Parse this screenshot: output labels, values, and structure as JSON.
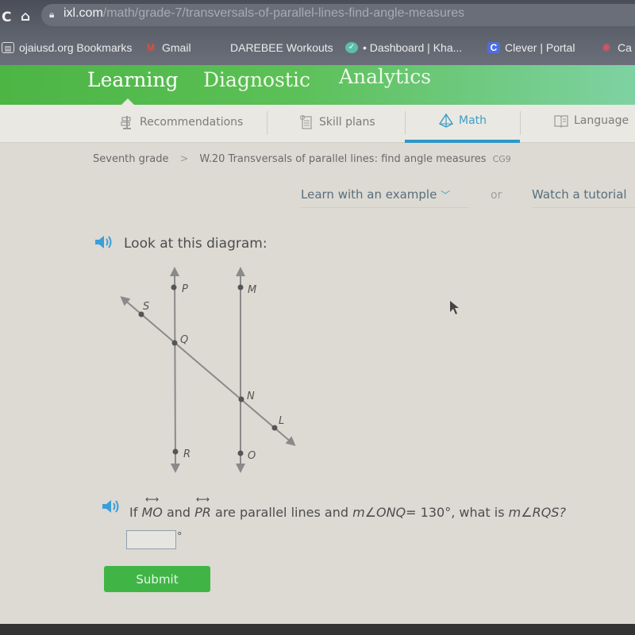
{
  "browser": {
    "reload_icon": "reload-icon",
    "home_icon": "home-icon",
    "lock_icon": "lock-icon",
    "url_host": "ixl.com",
    "url_path": "/math/grade-7/transversals-of-parallel-lines-find-angle-measures",
    "bookmarks": [
      {
        "label": "ojaiusd.org Bookmarks",
        "icon": "folder-icon"
      },
      {
        "label": "Gmail",
        "icon": "gmail-icon"
      },
      {
        "label": "DAREBEE Workouts",
        "icon": ""
      },
      {
        "label": "• Dashboard | Kha...",
        "icon": "khan-academy-icon"
      },
      {
        "label": "Clever | Portal",
        "icon": "clever-icon"
      },
      {
        "label": "Ca",
        "icon": "canvas-icon"
      }
    ]
  },
  "top_nav": {
    "items": [
      "Learning",
      "Diagnostic",
      "Analytics"
    ],
    "active": "Learning"
  },
  "subject_tabs": {
    "items": [
      "Recommendations",
      "Skill plans",
      "Math",
      "Language"
    ],
    "active": "Math",
    "accent_color": "#2c97c7"
  },
  "breadcrumb": {
    "grade": "Seventh grade",
    "separator": ">",
    "skill": "W.20 Transversals of parallel lines: find angle measures",
    "code": "CG9"
  },
  "help": {
    "learn_label": "Learn with an example",
    "or_label": "or",
    "tutorial_label": "Watch a tutorial"
  },
  "question": {
    "prompt": "Look at this diagram:",
    "diagram": {
      "points": [
        "P",
        "M",
        "S",
        "Q",
        "N",
        "L",
        "R",
        "O"
      ],
      "parallel_lines": [
        "MO",
        "PR"
      ],
      "transversal": "SL"
    },
    "text_parts": {
      "if": "If",
      "line1": "MO",
      "and": "and",
      "line2": "PR",
      "middle": "are parallel lines and",
      "given_angle": "m∠ONQ",
      "given_value": "= 130°,",
      "ask": "what is",
      "target_angle": "m∠RQS?"
    },
    "answer_value": "",
    "degree_symbol": "°"
  },
  "submit_label": "Submit",
  "colors": {
    "green": "#40b546",
    "blue": "#2c97c7"
  }
}
